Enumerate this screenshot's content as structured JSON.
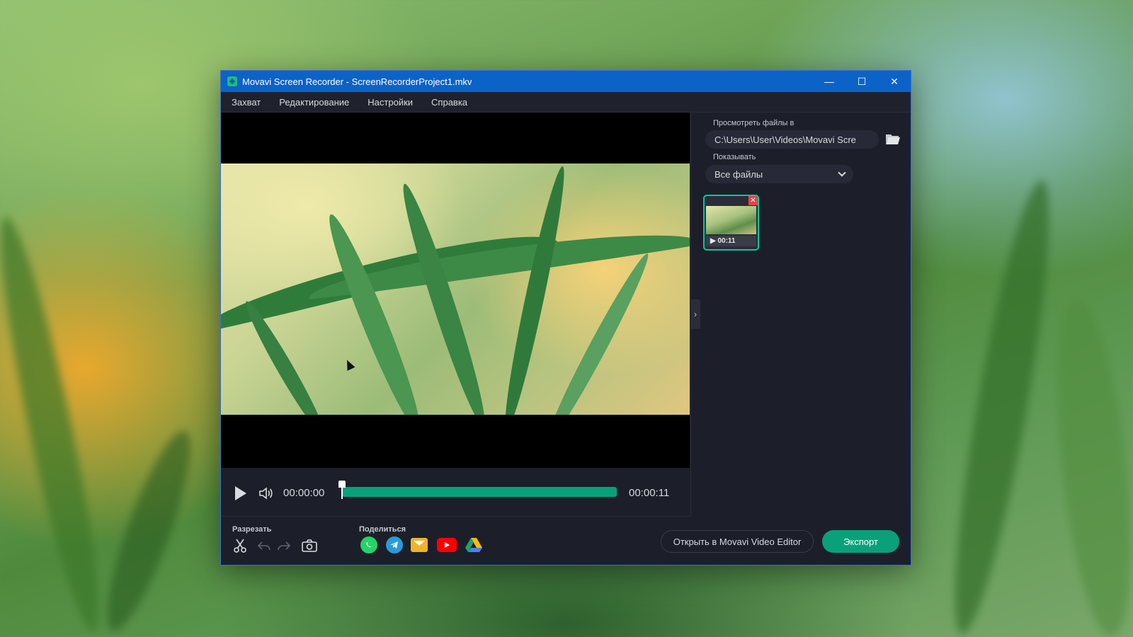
{
  "window": {
    "title": "Movavi Screen Recorder - ScreenRecorderProject1.mkv",
    "minimize_glyph": "—",
    "maximize_glyph": "☐",
    "close_glyph": "✕"
  },
  "menu": {
    "items": [
      {
        "label": "Захват"
      },
      {
        "label": "Редактирование"
      },
      {
        "label": "Настройки"
      },
      {
        "label": "Справка"
      }
    ]
  },
  "player": {
    "current_time": "00:00:00",
    "total_time": "00:00:11",
    "progress": 0
  },
  "sidebar": {
    "browse_label": "Просмотреть файлы в",
    "path_value": "C:\\Users\\User\\Videos\\Movavi Scre",
    "show_label": "Показывать",
    "filter_value": "Все файлы",
    "thumbnail": {
      "duration": "▶ 00:11",
      "close_glyph": "✕"
    },
    "collapse_glyph": "›"
  },
  "bottom": {
    "cut_label": "Разрезать",
    "share_label": "Поделиться",
    "open_editor_label": "Открыть в Movavi Video Editor",
    "export_label": "Экспорт"
  },
  "colors": {
    "accent": "#0aa07a",
    "titlebar": "#0b63c8",
    "window_bg": "#1c1f2a"
  }
}
